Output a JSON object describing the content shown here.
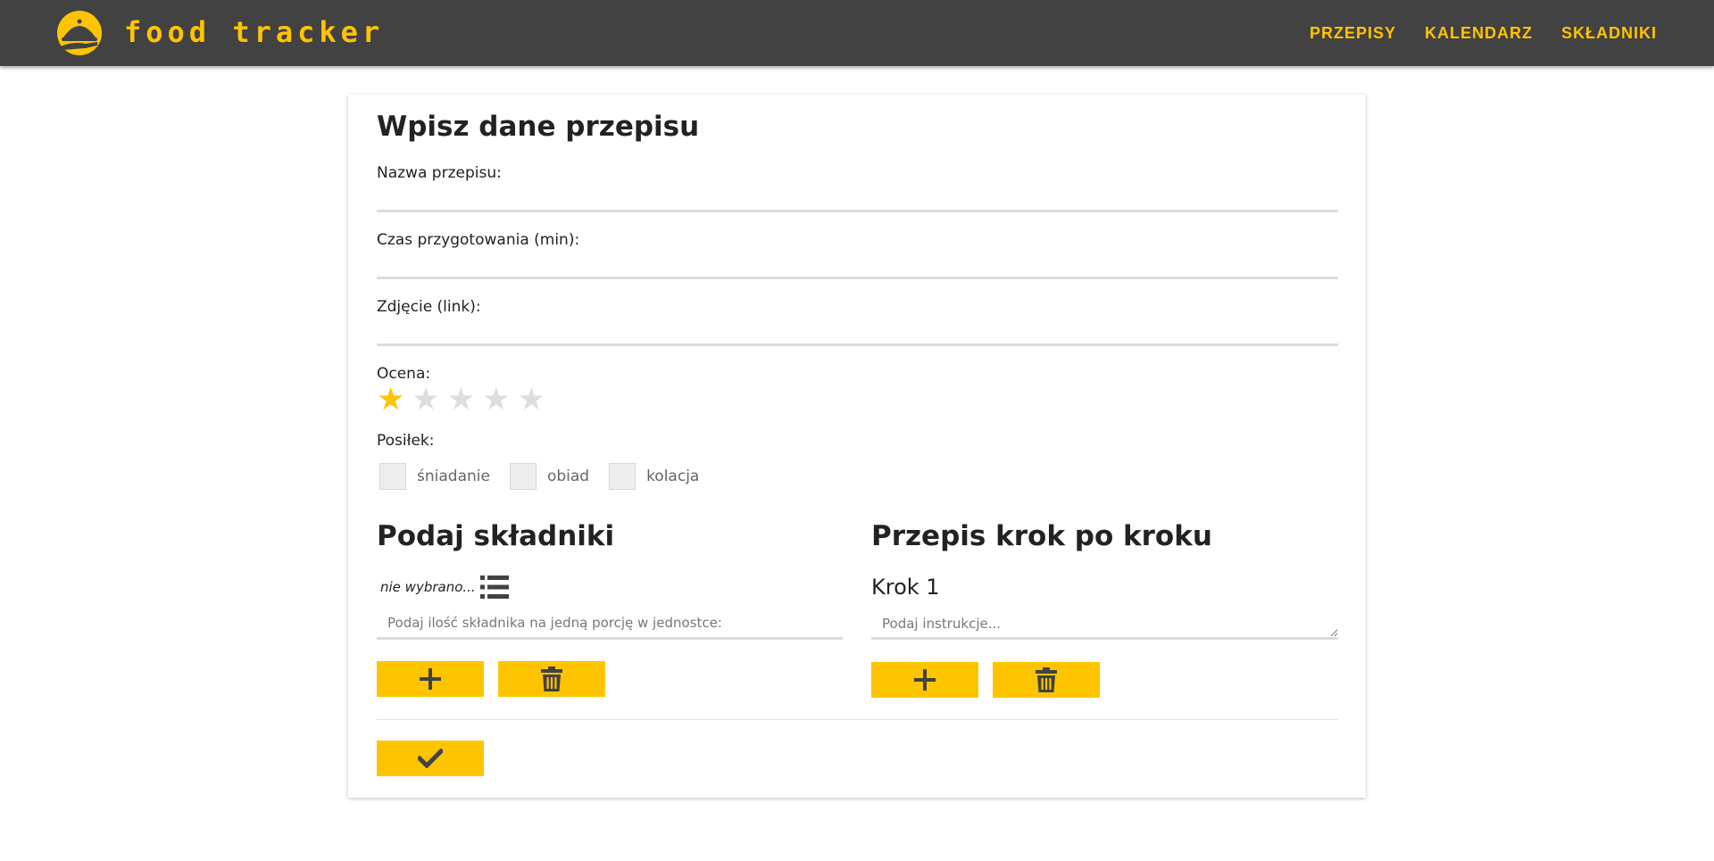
{
  "header": {
    "brand": "food tracker",
    "nav": [
      "PRZEPISY",
      "KALENDARZ",
      "SKŁADNIKI"
    ]
  },
  "form": {
    "title": "Wpisz dane przepisu",
    "name_label": "Nazwa przepisu:",
    "name_value": "",
    "time_label": "Czas przygotowania (min):",
    "time_value": "",
    "photo_label": "Zdjęcie (link):",
    "photo_value": "",
    "rating_label": "Ocena:",
    "rating": {
      "value": 1,
      "max": 5
    },
    "meal_label": "Posiłek:",
    "meals": [
      {
        "label": "śniadanie",
        "checked": false
      },
      {
        "label": "obiad",
        "checked": false
      },
      {
        "label": "kolacja",
        "checked": false
      }
    ]
  },
  "ingredients": {
    "title": "Podaj składniki",
    "selected": "nie wybrano...",
    "amount_placeholder": "Podaj ilość składnika na jedną porcję w jednostce:"
  },
  "steps": {
    "title": "Przepis krok po kroku",
    "step_label": "Krok 1",
    "instruction_placeholder": "Podaj instrukcje..."
  },
  "icons": {
    "logo": "cloche-icon",
    "add": "plus-icon",
    "delete": "trash-icon",
    "submit": "check-icon",
    "list": "list-icon"
  },
  "colors": {
    "accent": "#ffc400",
    "topbar": "#424242",
    "star_off": "#dddddd",
    "icon_dark": "#424242"
  }
}
